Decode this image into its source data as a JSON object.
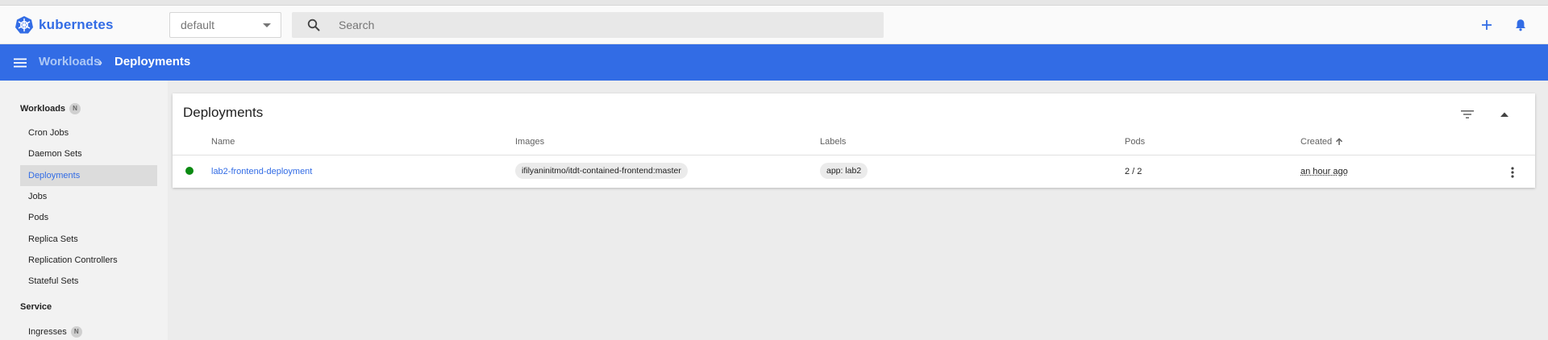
{
  "toolbar": {
    "brand": "kubernetes",
    "namespace": "default",
    "search_placeholder": "Search"
  },
  "breadcrumb": {
    "parent": "Workloads",
    "current": "Deployments"
  },
  "sidebar": {
    "sections": [
      {
        "title": "Workloads",
        "badge": "N",
        "items": [
          {
            "label": "Cron Jobs"
          },
          {
            "label": "Daemon Sets"
          },
          {
            "label": "Deployments",
            "active": true
          },
          {
            "label": "Jobs"
          },
          {
            "label": "Pods"
          },
          {
            "label": "Replica Sets"
          },
          {
            "label": "Replication Controllers"
          },
          {
            "label": "Stateful Sets"
          }
        ]
      },
      {
        "title": "Service",
        "items": [
          {
            "label": "Ingresses",
            "badge": "N"
          }
        ]
      }
    ]
  },
  "card": {
    "title": "Deployments",
    "columns": [
      "Name",
      "Images",
      "Labels",
      "Pods",
      "Created"
    ],
    "sort_column": "Created",
    "rows": [
      {
        "status": "running",
        "name": "lab2-frontend-deployment",
        "image": "ifilyaninitmo/itdt-contained-frontend:master",
        "label": "app: lab2",
        "pods": "2 / 2",
        "created": "an hour ago"
      }
    ]
  },
  "colors": {
    "brand_blue": "#326ce5",
    "status_running": "#0b8a12"
  }
}
